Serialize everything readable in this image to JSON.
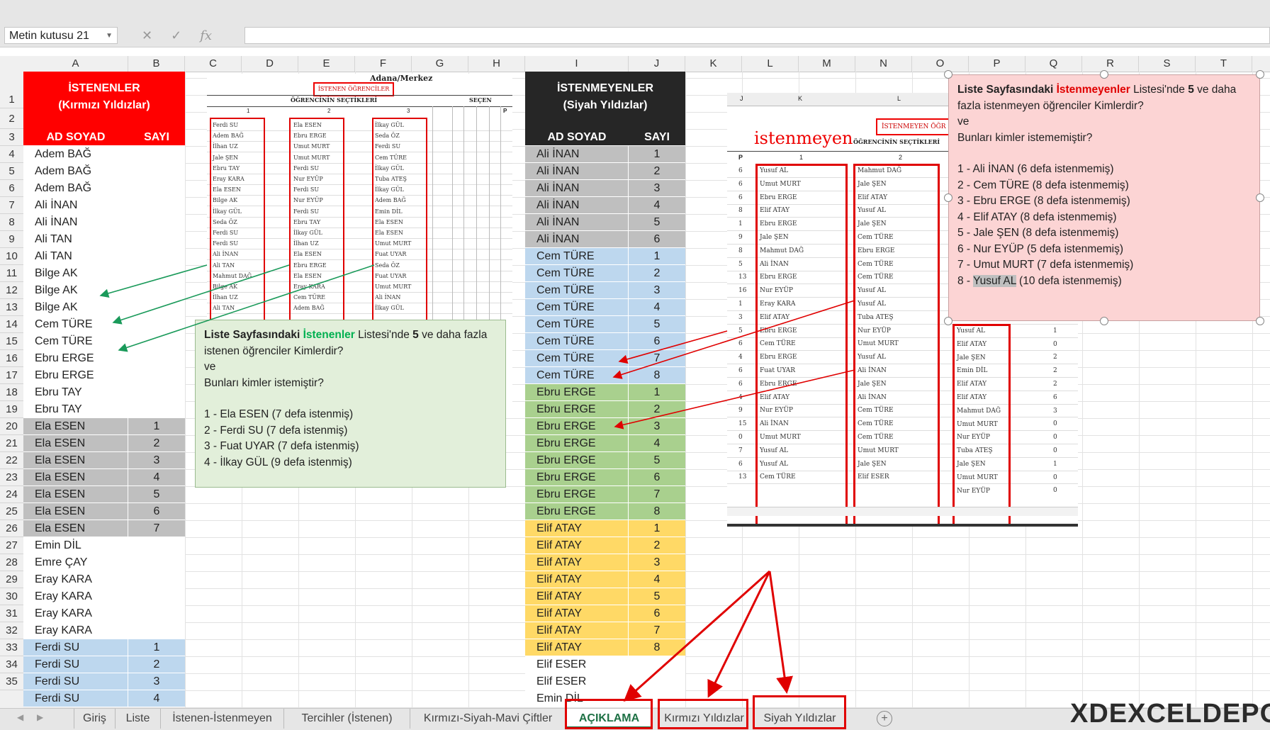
{
  "formula_bar": {
    "name_box": "Metin kutusu 21",
    "icons": [
      "✕",
      "✓",
      "fx"
    ]
  },
  "columns": [
    "A",
    "B",
    "C",
    "D",
    "E",
    "F",
    "G",
    "H",
    "I",
    "J",
    "K",
    "L",
    "M",
    "N",
    "O",
    "P",
    "Q",
    "R",
    "S",
    "T"
  ],
  "rows": [
    "1",
    "2",
    "3",
    "4",
    "5",
    "6",
    "7",
    "8",
    "9",
    "10",
    "11",
    "12",
    "13",
    "14",
    "15",
    "16",
    "17",
    "18",
    "19",
    "20",
    "21",
    "22",
    "23",
    "24",
    "25",
    "26",
    "27",
    "28",
    "29",
    "30",
    "31",
    "32",
    "33",
    "34",
    "35"
  ],
  "left_table": {
    "title_line1": "İSTENENLER",
    "title_line2": "(Kırmızı Yıldızlar)",
    "col_name": "AD SOYAD",
    "col_count": "SAYI",
    "rows": [
      {
        "name": "Adem BAĞ",
        "n": "",
        "bg": "#ffffff"
      },
      {
        "name": "Adem BAĞ",
        "n": "",
        "bg": "#ffffff"
      },
      {
        "name": "Adem BAĞ",
        "n": "",
        "bg": "#ffffff"
      },
      {
        "name": "Ali İNAN",
        "n": "",
        "bg": "#ffffff"
      },
      {
        "name": "Ali İNAN",
        "n": "",
        "bg": "#ffffff"
      },
      {
        "name": "Ali TAN",
        "n": "",
        "bg": "#ffffff"
      },
      {
        "name": "Ali TAN",
        "n": "",
        "bg": "#ffffff"
      },
      {
        "name": "Bilge AK",
        "n": "",
        "bg": "#ffffff"
      },
      {
        "name": "Bilge AK",
        "n": "",
        "bg": "#ffffff"
      },
      {
        "name": "Bilge AK",
        "n": "",
        "bg": "#ffffff"
      },
      {
        "name": "Cem TÜRE",
        "n": "",
        "bg": "#ffffff"
      },
      {
        "name": "Cem TÜRE",
        "n": "",
        "bg": "#ffffff"
      },
      {
        "name": "Ebru ERGE",
        "n": "",
        "bg": "#ffffff"
      },
      {
        "name": "Ebru ERGE",
        "n": "",
        "bg": "#ffffff"
      },
      {
        "name": "Ebru TAY",
        "n": "",
        "bg": "#ffffff"
      },
      {
        "name": "Ebru TAY",
        "n": "",
        "bg": "#ffffff"
      },
      {
        "name": "Ela ESEN",
        "n": "1",
        "bg": "#bfbfbf"
      },
      {
        "name": "Ela ESEN",
        "n": "2",
        "bg": "#bfbfbf"
      },
      {
        "name": "Ela ESEN",
        "n": "3",
        "bg": "#bfbfbf"
      },
      {
        "name": "Ela ESEN",
        "n": "4",
        "bg": "#bfbfbf"
      },
      {
        "name": "Ela ESEN",
        "n": "5",
        "bg": "#bfbfbf"
      },
      {
        "name": "Ela ESEN",
        "n": "6",
        "bg": "#bfbfbf"
      },
      {
        "name": "Ela ESEN",
        "n": "7",
        "bg": "#bfbfbf"
      },
      {
        "name": "Emin DİL",
        "n": "",
        "bg": "#ffffff"
      },
      {
        "name": "Emre ÇAY",
        "n": "",
        "bg": "#ffffff"
      },
      {
        "name": "Eray KARA",
        "n": "",
        "bg": "#ffffff"
      },
      {
        "name": "Eray KARA",
        "n": "",
        "bg": "#ffffff"
      },
      {
        "name": "Eray KARA",
        "n": "",
        "bg": "#ffffff"
      },
      {
        "name": "Eray KARA",
        "n": "",
        "bg": "#ffffff"
      },
      {
        "name": "Ferdi SU",
        "n": "1",
        "bg": "#bdd7ee"
      },
      {
        "name": "Ferdi SU",
        "n": "2",
        "bg": "#bdd7ee"
      },
      {
        "name": "Ferdi SU",
        "n": "3",
        "bg": "#bdd7ee"
      },
      {
        "name": "Ferdi SU",
        "n": "4",
        "bg": "#bdd7ee"
      }
    ]
  },
  "right_table": {
    "title_line1": "İSTENMEYENLER",
    "title_line2": "(Siyah Yıldızlar)",
    "col_name": "AD SOYAD",
    "col_count": "SAYI",
    "rows": [
      {
        "name": "Ali İNAN",
        "n": "1",
        "bg": "#bfbfbf"
      },
      {
        "name": "Ali İNAN",
        "n": "2",
        "bg": "#bfbfbf"
      },
      {
        "name": "Ali İNAN",
        "n": "3",
        "bg": "#bfbfbf"
      },
      {
        "name": "Ali İNAN",
        "n": "4",
        "bg": "#bfbfbf"
      },
      {
        "name": "Ali İNAN",
        "n": "5",
        "bg": "#bfbfbf"
      },
      {
        "name": "Ali İNAN",
        "n": "6",
        "bg": "#bfbfbf"
      },
      {
        "name": "Cem TÜRE",
        "n": "1",
        "bg": "#bdd7ee"
      },
      {
        "name": "Cem TÜRE",
        "n": "2",
        "bg": "#bdd7ee"
      },
      {
        "name": "Cem TÜRE",
        "n": "3",
        "bg": "#bdd7ee"
      },
      {
        "name": "Cem TÜRE",
        "n": "4",
        "bg": "#bdd7ee"
      },
      {
        "name": "Cem TÜRE",
        "n": "5",
        "bg": "#bdd7ee"
      },
      {
        "name": "Cem TÜRE",
        "n": "6",
        "bg": "#bdd7ee"
      },
      {
        "name": "Cem TÜRE",
        "n": "7",
        "bg": "#bdd7ee"
      },
      {
        "name": "Cem TÜRE",
        "n": "8",
        "bg": "#bdd7ee"
      },
      {
        "name": "Ebru ERGE",
        "n": "1",
        "bg": "#a9d08e"
      },
      {
        "name": "Ebru ERGE",
        "n": "2",
        "bg": "#a9d08e"
      },
      {
        "name": "Ebru ERGE",
        "n": "3",
        "bg": "#a9d08e"
      },
      {
        "name": "Ebru ERGE",
        "n": "4",
        "bg": "#a9d08e"
      },
      {
        "name": "Ebru ERGE",
        "n": "5",
        "bg": "#a9d08e"
      },
      {
        "name": "Ebru ERGE",
        "n": "6",
        "bg": "#a9d08e"
      },
      {
        "name": "Ebru ERGE",
        "n": "7",
        "bg": "#a9d08e"
      },
      {
        "name": "Ebru ERGE",
        "n": "8",
        "bg": "#a9d08e"
      },
      {
        "name": "Elif ATAY",
        "n": "1",
        "bg": "#ffd966"
      },
      {
        "name": "Elif ATAY",
        "n": "2",
        "bg": "#ffd966"
      },
      {
        "name": "Elif ATAY",
        "n": "3",
        "bg": "#ffd966"
      },
      {
        "name": "Elif ATAY",
        "n": "4",
        "bg": "#ffd966"
      },
      {
        "name": "Elif ATAY",
        "n": "5",
        "bg": "#ffd966"
      },
      {
        "name": "Elif ATAY",
        "n": "6",
        "bg": "#ffd966"
      },
      {
        "name": "Elif ATAY",
        "n": "7",
        "bg": "#ffd966"
      },
      {
        "name": "Elif ATAY",
        "n": "8",
        "bg": "#ffd966"
      },
      {
        "name": "Elif ESER",
        "n": "",
        "bg": "#ffffff"
      },
      {
        "name": "Elif ESER",
        "n": "",
        "bg": "#ffffff"
      },
      {
        "name": "Emin DİL",
        "n": "",
        "bg": "#ffffff"
      }
    ]
  },
  "note_green": {
    "lead": "Liste Sayfasındaki ",
    "highlight": "İstenenler",
    "mid": " Listesi'nde ",
    "five": "5",
    "rest": " ve daha fazla istenen öğrenciler Kimlerdir?",
    "ve": "ve",
    "q2": "Bunları kimler istemiştir?",
    "items": [
      "1 - Ela ESEN (7 defa istenmiş)",
      "2 - Ferdi SU (7 defa istenmiş)",
      "3 - Fuat UYAR (7 defa istenmiş)",
      "4 - İlkay GÜL (9 defa istenmiş)"
    ]
  },
  "note_pink": {
    "lead": "Liste Sayfasındaki ",
    "highlight": "İstenmeyenler",
    "mid": " Listesi'nde ",
    "five": "5",
    "rest": " ve daha fazla istenmeyen öğrenciler Kimlerdir?",
    "ve": "ve",
    "q2": "Bunları kimler istememiştir?",
    "items": [
      "1 - Ali İNAN (6 defa istenmemiş)",
      "2 - Cem TÜRE (8 defa istenmemiş)",
      "3 - Ebru ERGE (8 defa istenmemiş)",
      "4 - Elif ATAY (8 defa istenmemiş)",
      "5 - Jale ŞEN (8 defa istenmemiş)",
      "6 - Nur EYÜP (5 defa istenmemiş)",
      "7 - Umut MURT (7 defa istenmemiş)"
    ],
    "last_prefix": "8 - ",
    "last_hl": "Yusuf AL",
    "last_rest": " (10 defa istenmemiş)"
  },
  "img_left": {
    "header": "Adana/Merkez",
    "box_title": "İSTENEN ÖĞRENCİLER",
    "sub": "ÖĞRENCİNİN SEÇTİKLERİ",
    "secen": "SEÇEN",
    "cols": [
      "1",
      "2",
      "3"
    ],
    "pcol": "P",
    "col1": [
      "Ferdi SU",
      "Adem BAĞ",
      "İlhan UZ",
      "Jale ŞEN",
      "Ebru TAY",
      "Eray KARA",
      "Ela ESEN",
      "Bilge AK",
      "İlkay GÜL",
      "Seda ÖZ",
      "Ferdi SU",
      "Ferdi SU",
      "Ali İNAN",
      "Ali TAN",
      "Mahmut DAĞ",
      "Bilge AK",
      "İlhan UZ",
      "Ali TAN"
    ],
    "col2": [
      "Ela ESEN",
      "Ebru ERGE",
      "Umut MURT",
      "Umut MURT",
      "Ferdi SU",
      "Nur EYÜP",
      "Ferdi SU",
      "Nur EYÜP",
      "Ferdi SU",
      "Ebru TAY",
      "İlkay GÜL",
      "İlhan UZ",
      "Ela ESEN",
      "Ebru ERGE",
      "Ela ESEN",
      "Eray KARA",
      "Cem TÜRE",
      "Adem BAĞ"
    ],
    "col3": [
      "İlkay GÜL",
      "Seda ÖZ",
      "Ferdi SU",
      "Cem TÜRE",
      "İlkay GÜL",
      "Tuba ATEŞ",
      "İlkay GÜL",
      "Adem BAĞ",
      "Emin DİL",
      "Ela ESEN",
      "Ela ESEN",
      "Umut MURT",
      "Fuat UYAR",
      "Seda ÖZ",
      "Fuat UYAR",
      "Umut MURT",
      "Ali İNAN",
      "İlkay GÜL"
    ]
  },
  "img_right": {
    "top_cols": [
      "J",
      "K",
      "L"
    ],
    "big_word": "istenmeyen",
    "box_title": "İSTENMEYEN ÖĞR",
    "sub": "ÖĞRENCİNİN SEÇTİKLERİ",
    "pcol": "P",
    "cols": [
      "1",
      "2"
    ],
    "pnums": [
      "6",
      "6",
      "6",
      "8",
      "1",
      "9",
      "8",
      "5",
      "13",
      "16",
      "1",
      "3",
      "5",
      "6",
      "4",
      "6",
      "6",
      "4",
      "9",
      "15",
      "0",
      "7",
      "6",
      "13",
      "0"
    ],
    "col1": [
      "Yusuf AL",
      "Umut MURT",
      "Ebru ERGE",
      "Elif ATAY",
      "Ebru ERGE",
      "Jale ŞEN",
      "Mahmut DAĞ",
      "Ali İNAN",
      "Ebru ERGE",
      "Nur EYÜP",
      "Eray KARA",
      "Elif ATAY",
      "Ebru ERGE",
      "Cem TÜRE",
      "Ebru ERGE",
      "Fuat UYAR",
      "Ebru ERGE",
      "Elif ATAY",
      "Nur EYÜP",
      "Ali İNAN",
      "Umut MURT",
      "Yusuf AL",
      "Yusuf AL",
      "Cem TÜRE"
    ],
    "col2": [
      "Mahmut DAĞ",
      "Jale ŞEN",
      "Elif ATAY",
      "Yusuf AL",
      "Jale ŞEN",
      "Cem TÜRE",
      "Ebru ERGE",
      "Cem TÜRE",
      "Cem TÜRE",
      "Yusuf AL",
      "Yusuf AL",
      "Tuba ATEŞ",
      "Nur EYÜP",
      "Umut MURT",
      "Yusuf AL",
      "Ali İNAN",
      "Jale ŞEN",
      "Ali İNAN",
      "Cem TÜRE",
      "Cem TÜRE",
      "Cem TÜRE",
      "Umut MURT",
      "Jale ŞEN",
      "Elif ESER"
    ],
    "col3": [
      "Yusuf AL",
      "Elif ATAY",
      "Jale ŞEN",
      "Emin DİL",
      "Elif ATAY",
      "Elif ATAY",
      "Mahmut DAĞ",
      "Umut MURT",
      "Nur EYÜP",
      "Tuba ATEŞ",
      "Jale ŞEN",
      "Umut MURT",
      "Nur EYÜP"
    ],
    "col4": [
      "1",
      "1",
      "0",
      "2",
      "2",
      "2",
      "6",
      "3",
      "0",
      "0",
      "0",
      "1",
      "0",
      "0"
    ]
  },
  "tabs": [
    {
      "label": "Giriş",
      "active": false
    },
    {
      "label": "Liste",
      "active": false
    },
    {
      "label": "İstenen-İstenmeyen",
      "active": false
    },
    {
      "label": "Tercihler (İstenen)",
      "active": false
    },
    {
      "label": "Kırmızı-Siyah-Mavi Çiftler",
      "active": false
    },
    {
      "label": "AÇIKLAMA",
      "active": true
    },
    {
      "label": "Kırmızı Yıldızlar",
      "active": false
    },
    {
      "label": "Siyah Yıldızlar",
      "active": false
    }
  ],
  "logo": {
    "text": "XDEXCELDEPO"
  },
  "colors": {
    "accent": "#1e7145",
    "red": "#e00000",
    "green_arrow": "#1a9a5a"
  }
}
